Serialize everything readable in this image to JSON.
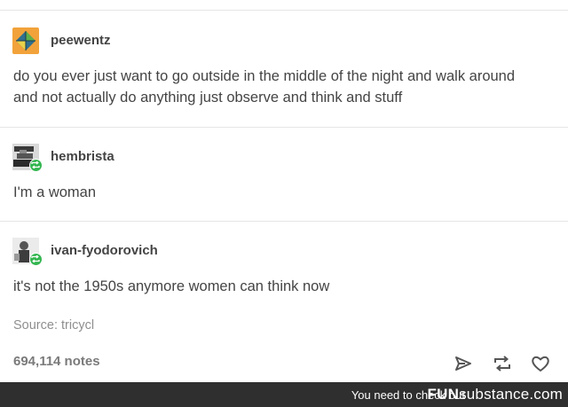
{
  "posts": [
    {
      "username": "peewentz",
      "avatar_icon": "orange-diamond-avatar",
      "text_lines": [
        "do you ever just want to go outside in the middle of the night and walk around",
        "and not actually do anything just observe and think and stuff"
      ]
    },
    {
      "username": "hembrista",
      "avatar_icon": "dark-photo-avatar",
      "badge_icon": "reblog-icon",
      "text_lines": [
        "I'm a woman"
      ]
    },
    {
      "username": "ivan-fyodorovich",
      "avatar_icon": "portrait-photo-avatar",
      "badge_icon": "reblog-icon",
      "text_lines": [
        "it's not the 1950s anymore women can think now"
      ]
    }
  ],
  "source": "Source: tricycl",
  "notes": "694,114 notes",
  "actions": [
    {
      "icon": "share-icon"
    },
    {
      "icon": "reblog-icon"
    },
    {
      "icon": "heart-icon"
    }
  ],
  "footer": {
    "text": "You need to check out",
    "brand_bold": "FUN",
    "brand_rest": "substance",
    "brand_suffix": ".com"
  },
  "colors": {
    "text": "#444444",
    "muted": "#8f8f8f",
    "reblog_badge": "#35b651",
    "avatar_orange": "#f2a23a",
    "footer_bg": "#2f2f2f"
  }
}
